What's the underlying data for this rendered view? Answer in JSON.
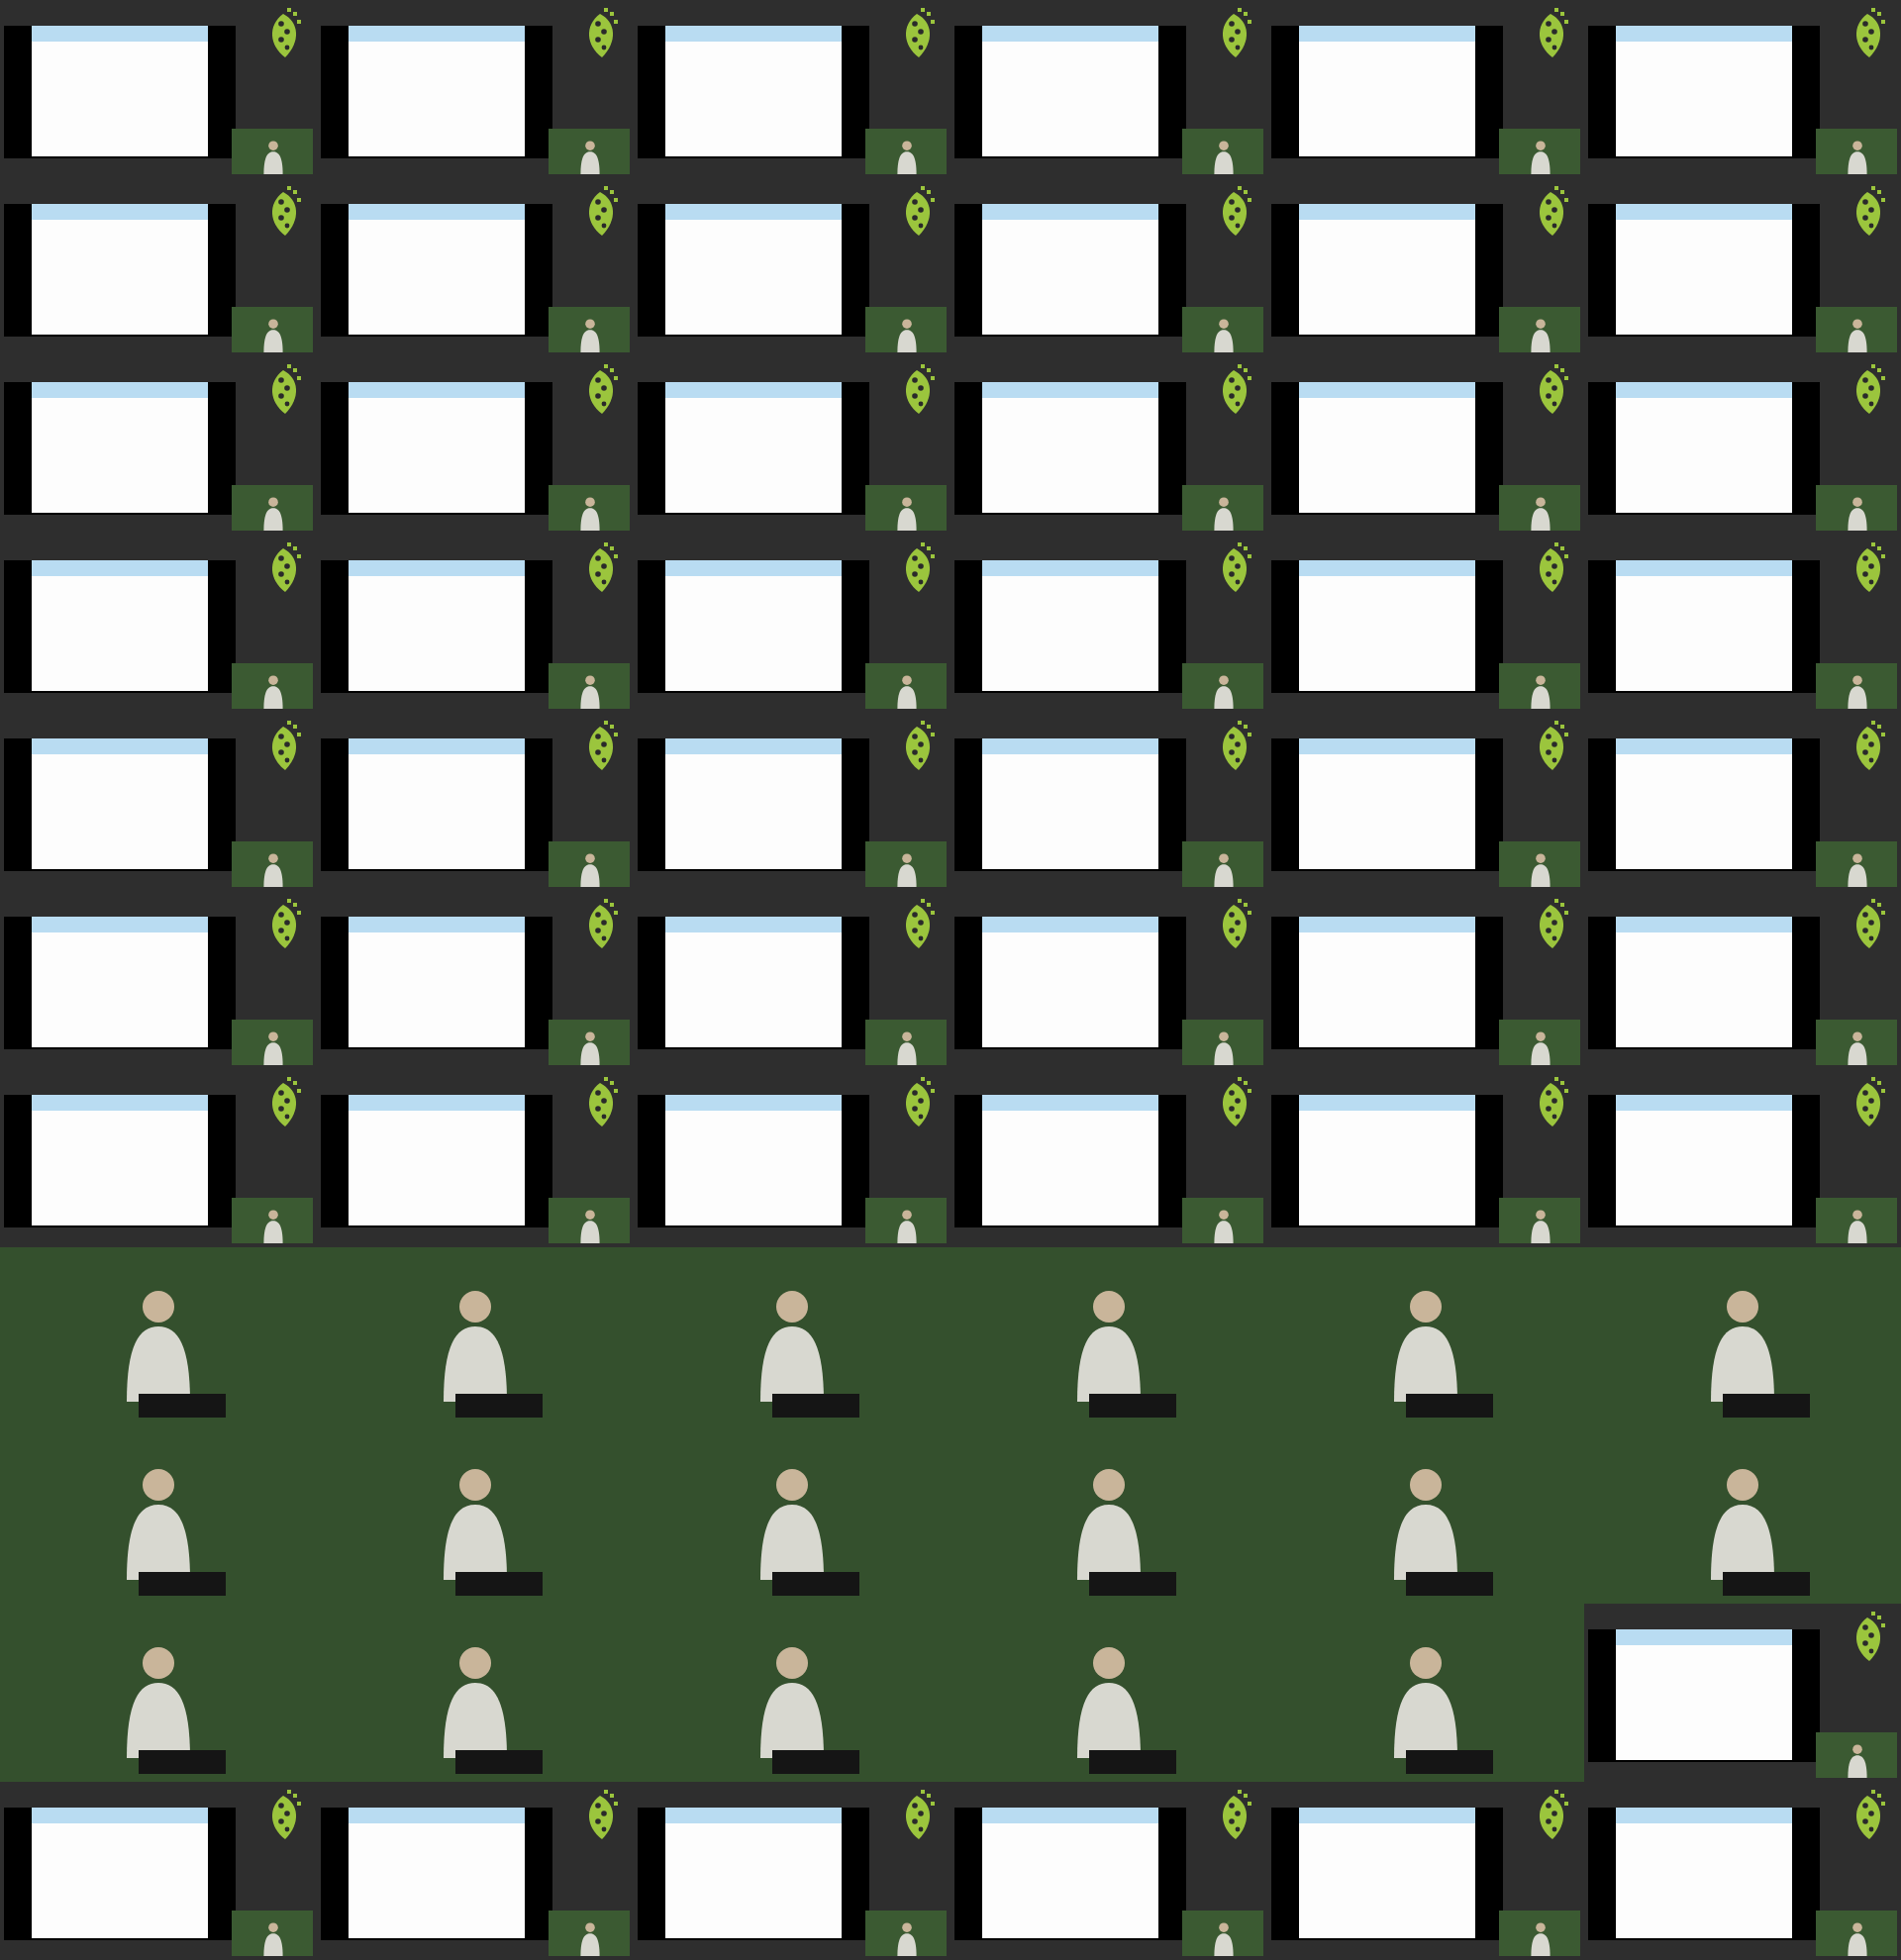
{
  "frames": [
    {
      "kind": "slide"
    },
    {
      "kind": "slide"
    },
    {
      "kind": "slide"
    },
    {
      "kind": "slide"
    },
    {
      "kind": "slide"
    },
    {
      "kind": "slide"
    },
    {
      "kind": "slide"
    },
    {
      "kind": "slide"
    },
    {
      "kind": "slide"
    },
    {
      "kind": "slide"
    },
    {
      "kind": "slide"
    },
    {
      "kind": "slide"
    },
    {
      "kind": "slide"
    },
    {
      "kind": "slide"
    },
    {
      "kind": "slide"
    },
    {
      "kind": "slide"
    },
    {
      "kind": "slide"
    },
    {
      "kind": "slide"
    },
    {
      "kind": "slide"
    },
    {
      "kind": "slide"
    },
    {
      "kind": "slide"
    },
    {
      "kind": "slide"
    },
    {
      "kind": "slide"
    },
    {
      "kind": "slide"
    },
    {
      "kind": "slide"
    },
    {
      "kind": "slide"
    },
    {
      "kind": "slide"
    },
    {
      "kind": "slide"
    },
    {
      "kind": "slide"
    },
    {
      "kind": "slide"
    },
    {
      "kind": "slide"
    },
    {
      "kind": "slide"
    },
    {
      "kind": "slide"
    },
    {
      "kind": "slide"
    },
    {
      "kind": "slide"
    },
    {
      "kind": "slide"
    },
    {
      "kind": "slide"
    },
    {
      "kind": "slide"
    },
    {
      "kind": "slide"
    },
    {
      "kind": "slide"
    },
    {
      "kind": "slide"
    },
    {
      "kind": "slide"
    },
    {
      "kind": "speaker"
    },
    {
      "kind": "speaker"
    },
    {
      "kind": "speaker"
    },
    {
      "kind": "speaker"
    },
    {
      "kind": "speaker"
    },
    {
      "kind": "speaker"
    },
    {
      "kind": "speaker"
    },
    {
      "kind": "speaker"
    },
    {
      "kind": "speaker"
    },
    {
      "kind": "speaker"
    },
    {
      "kind": "speaker"
    },
    {
      "kind": "speaker"
    },
    {
      "kind": "speaker"
    },
    {
      "kind": "speaker"
    },
    {
      "kind": "speaker"
    },
    {
      "kind": "speaker"
    },
    {
      "kind": "speaker"
    },
    {
      "kind": "slide"
    },
    {
      "kind": "slide"
    },
    {
      "kind": "slide"
    },
    {
      "kind": "slide"
    },
    {
      "kind": "slide"
    },
    {
      "kind": "slide"
    },
    {
      "kind": "slide"
    }
  ]
}
